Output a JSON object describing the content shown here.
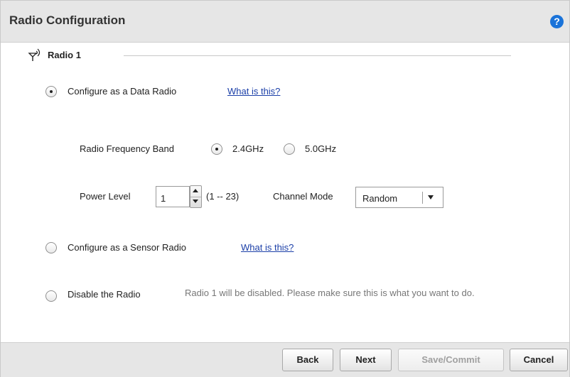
{
  "header": {
    "title": "Radio Configuration",
    "help_icon": "help-circle-icon"
  },
  "section": {
    "label": "Radio 1",
    "icon": "antenna-icon"
  },
  "options": {
    "data_radio": {
      "label": "Configure as a Data Radio",
      "link": "What is this?",
      "selected": true
    },
    "sensor_radio": {
      "label": "Configure as a Sensor Radio",
      "link": "What is this?",
      "selected": false
    },
    "disable_radio": {
      "label": "Disable the Radio",
      "note": "Radio 1 will be disabled. Please make sure this is what you want to do.",
      "selected": false
    }
  },
  "frequency": {
    "label": "Radio Frequency Band",
    "options": [
      {
        "label": "2.4GHz",
        "selected": true
      },
      {
        "label": "5.0GHz",
        "selected": false
      }
    ]
  },
  "power": {
    "label": "Power Level",
    "value": "1",
    "range": "(1 -- 23)"
  },
  "channel": {
    "label": "Channel Mode",
    "value": "Random"
  },
  "footer": {
    "back": "Back",
    "next": "Next",
    "save": "Save/Commit",
    "cancel": "Cancel"
  }
}
